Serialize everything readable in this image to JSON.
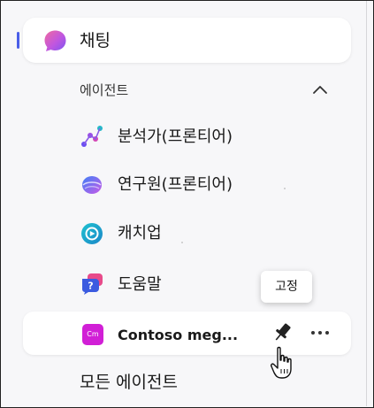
{
  "nav": {
    "chat_label": "채팅"
  },
  "agents_section": {
    "header": "에이전트",
    "items": [
      {
        "label": "분석가(프론티어)",
        "icon": "analyst-icon"
      },
      {
        "label": "연구원(프론티어)",
        "icon": "researcher-icon"
      },
      {
        "label": "캐치업",
        "icon": "catchup-icon"
      },
      {
        "label": "도움말",
        "icon": "help-icon"
      }
    ],
    "hovered_item": {
      "label": "Contoso meg...",
      "icon_text": "Cm",
      "icon_color": "#d11fd6"
    },
    "all_agents_label": "모든 에이전트"
  },
  "tooltip": {
    "text": "고정"
  },
  "colors": {
    "accent": "#4a5ee8",
    "background": "#f7f7f9",
    "selected_bg": "#ffffff"
  },
  "icons": [
    "chat-icon",
    "chevron-up-icon",
    "analyst-icon",
    "researcher-icon",
    "catchup-icon",
    "help-icon",
    "pin-icon",
    "more-icon",
    "hand-cursor-icon"
  ]
}
